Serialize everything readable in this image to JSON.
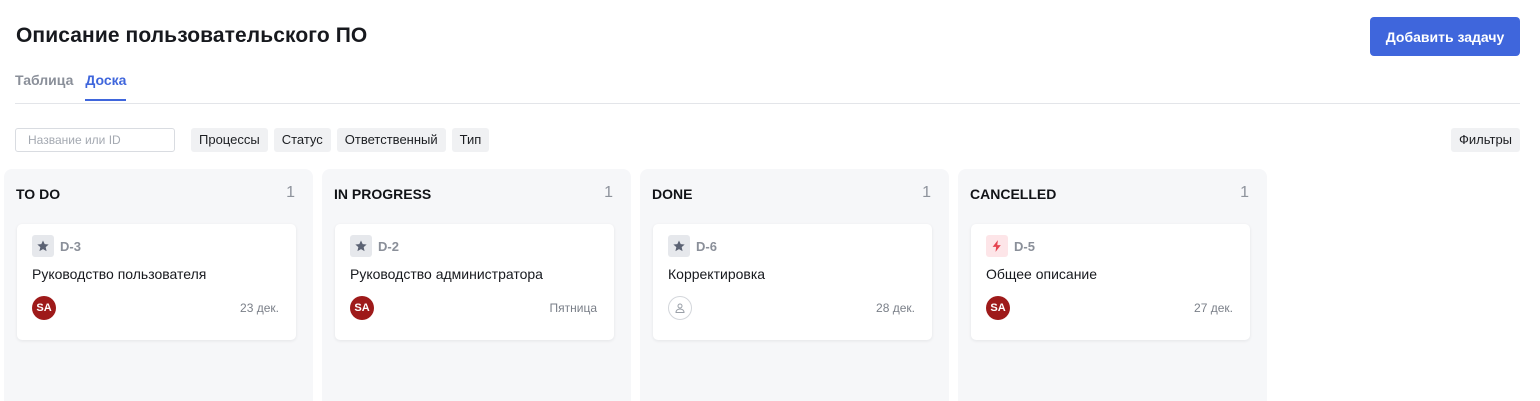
{
  "header": {
    "title": "Описание пользовательского ПО",
    "add_button_label": "Добавить задачу"
  },
  "tabs": [
    {
      "label": "Таблица",
      "active": false
    },
    {
      "label": "Доска",
      "active": true
    }
  ],
  "toolbar": {
    "search_placeholder": "Название или ID",
    "search_value": "",
    "chips": [
      "Процессы",
      "Статус",
      "Ответственный",
      "Тип"
    ],
    "filters_label": "Фильтры"
  },
  "columns": [
    {
      "title": "TO DO",
      "count": "1",
      "cards": [
        {
          "id": "D-3",
          "title": "Руководство пользователя",
          "type_icon": "star-icon",
          "assignee": "SA",
          "due": "23 дек."
        }
      ]
    },
    {
      "title": "IN PROGRESS",
      "count": "1",
      "cards": [
        {
          "id": "D-2",
          "title": "Руководство администратора",
          "type_icon": "star-icon",
          "assignee": "SA",
          "due": "Пятница"
        }
      ]
    },
    {
      "title": "DONE",
      "count": "1",
      "cards": [
        {
          "id": "D-6",
          "title": "Корректировка",
          "type_icon": "star-icon",
          "assignee": "",
          "due": "28 дек."
        }
      ]
    },
    {
      "title": "CANCELLED",
      "count": "1",
      "cards": [
        {
          "id": "D-5",
          "title": "Общее описание",
          "type_icon": "lightning-icon",
          "assignee": "SA",
          "due": "27 дек."
        }
      ]
    }
  ],
  "colors": {
    "accent": "#3f66dc",
    "avatar": "#9e1a1a",
    "column_bg": "#f6f7f9",
    "lightning": "#e5434f",
    "star": "#5b6273"
  }
}
